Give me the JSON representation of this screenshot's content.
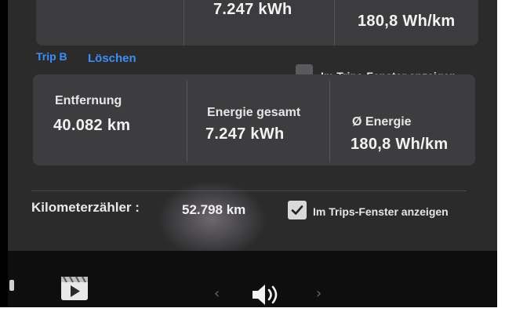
{
  "trip_a": {
    "energy_total": "7.247 kWh",
    "avg_energy": "180,8 Wh/km"
  },
  "trip_b": {
    "label": "Trip B",
    "clear_label": "Löschen",
    "show_in_trips_label": "Im Trips-Fenster anzeigen",
    "show_in_trips_checked": false,
    "distance_label": "Entfernung",
    "distance_value": "40.082 km",
    "energy_label": "Energie gesamt",
    "energy_value": "7.247 kWh",
    "avg_label": "Ø Energie",
    "avg_value": "180,8 Wh/km"
  },
  "odometer": {
    "label": "Kilometerzähler :",
    "value": "52.798 km",
    "show_in_trips_label": "Im Trips-Fenster anzeigen",
    "show_in_trips_checked": true
  },
  "dock": {
    "icons": [
      "media-player-icon",
      "previous-chevron-icon",
      "volume-icon",
      "next-chevron-icon"
    ],
    "prev_glyph": "‹",
    "next_glyph": "›"
  },
  "colors": {
    "accent": "#3e8ef7",
    "background": "#2b2b2c",
    "panel": "#3d3d3f"
  }
}
